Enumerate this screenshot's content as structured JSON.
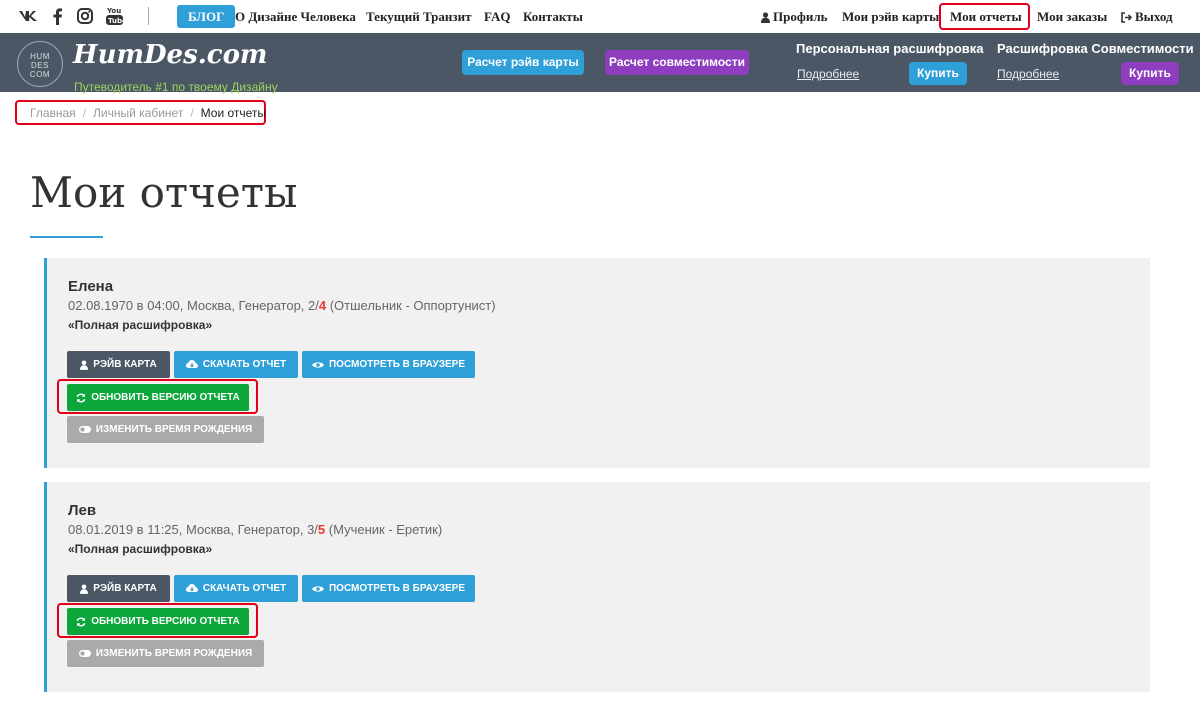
{
  "topbar": {
    "social": [
      {
        "name": "vk-icon"
      },
      {
        "name": "facebook-icon"
      },
      {
        "name": "instagram-icon"
      },
      {
        "name": "youtube-icon"
      }
    ],
    "blog": "БЛОГ",
    "nav": [
      "О Дизайне Человека",
      "Текущий Транзит",
      "FAQ",
      "Контакты"
    ],
    "profile": "Профиль",
    "rave_maps": "Мои рэйв карты",
    "reports": "Мои отчеты",
    "orders": "Мои заказы",
    "logout": "Выход"
  },
  "header": {
    "logo_circle": [
      "HUM",
      "DES",
      "COM"
    ],
    "logo_text": "HumDes.com",
    "tagline": "Путеводитель #1 по твоему Дизайну",
    "btn_rave": "Расчет рэйв карты",
    "btn_compat": "Расчет совместимости",
    "personal_title": "Персональная расшифровка",
    "personal_more": "Подробнее",
    "personal_buy": "Купить",
    "compat_title": "Расшифровка Совместимости",
    "compat_more": "Подробнее",
    "compat_buy": "Купить"
  },
  "breadcrumbs": {
    "home": "Главная",
    "cabinet": "Личный кабинет",
    "current": "Мои отчеты"
  },
  "page_title": "Мои отчеты",
  "buttons": {
    "rave": "РЭЙВ КАРТА",
    "download": "СКАЧАТЬ ОТЧЕТ",
    "view": "ПОСМОТРЕТЬ В БРАУЗЕРЕ",
    "update": "ОБНОВИТЬ ВЕРСИЮ ОТЧЕТА",
    "change_time": "ИЗМЕНИТЬ ВРЕМЯ РОЖДЕНИЯ"
  },
  "reports": [
    {
      "name": "Елена",
      "info_prefix": "02.08.1970 в 04:00, Москва, Генератор, 2/",
      "line_highlight": "4",
      "info_suffix": " (Отшельник - Оппортунист)",
      "type": "«Полная расшифровка»"
    },
    {
      "name": "Лев",
      "info_prefix": "08.01.2019 в 11:25, Москва, Генератор, 3/",
      "line_highlight": "5",
      "info_suffix": " (Мученик - Еретик)",
      "type": "«Полная расшифровка»"
    }
  ],
  "colors": {
    "accent_blue": "#2f9fd8",
    "header_bg": "#4c5766",
    "purple": "#8e3dbf",
    "green": "#0ca63a",
    "highlight_red": "#e0001b"
  }
}
